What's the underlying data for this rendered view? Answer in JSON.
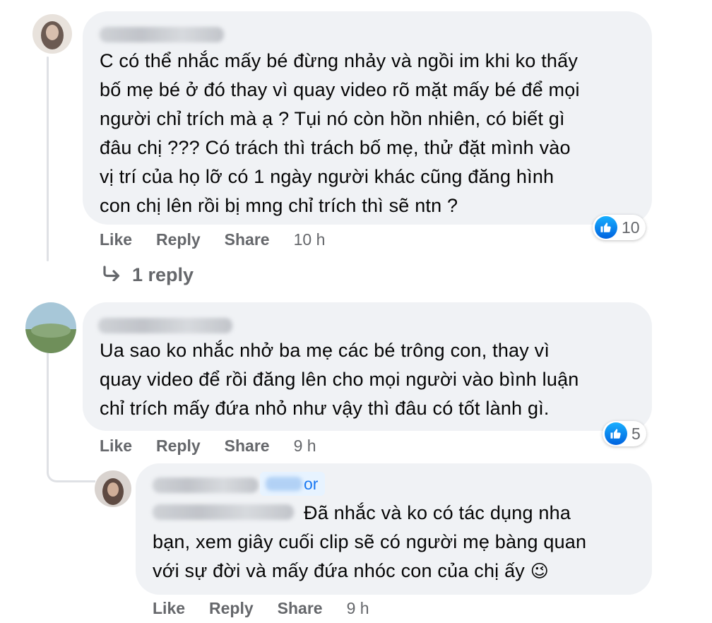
{
  "comments": [
    {
      "text": "C có thể nhắc mấy bé đừng nhảy và ngồi im khi ko thấy\nbố mẹ bé ở đó thay vì quay video rõ mặt mấy bé để mọi\nngười chỉ trích mà ạ ? Tụi nó còn hồn nhiên, có biết gì\nđâu chị ??? Có trách thì trách bố mẹ, thử đặt mình vào\nvị trí của họ lỡ có 1 ngày người khác cũng đăng hình\ncon chị lên rồi bị mng chỉ trích thì sẽ ntn ?",
      "like_label": "Like",
      "reply_label": "Reply",
      "share_label": "Share",
      "time": "10 h",
      "reaction_count": "10",
      "reply_link": "1 reply"
    },
    {
      "text": "Ua sao ko nhắc nhở ba mẹ các bé trông con, thay vì\nquay video để rồi đăng lên cho mọi người vào bình luận\nchỉ trích mấy đứa nhỏ như vậy thì đâu có tốt lành gì.",
      "like_label": "Like",
      "reply_label": "Reply",
      "share_label": "Share",
      "time": "9 h",
      "reaction_count": "5"
    }
  ],
  "reply": {
    "author_badge": "or",
    "text_line1": "Đã nhắc và ko có tác dụng nha",
    "text_rest": "bạn, xem giây cuối clip sẽ có người mẹ bàng quan\nvới sự đời và mấy đứa nhóc con của chị ấy",
    "emoji": "😉",
    "like_label": "Like",
    "reply_label": "Reply",
    "share_label": "Share",
    "time": "9 h"
  },
  "icons": {
    "reaction": "like-thumb-icon",
    "reply_arrow": "reply-arrow-icon"
  },
  "colors": {
    "bubble": "#f0f2f5",
    "secondary_text": "#65676b",
    "like_blue": "#1877f2"
  }
}
